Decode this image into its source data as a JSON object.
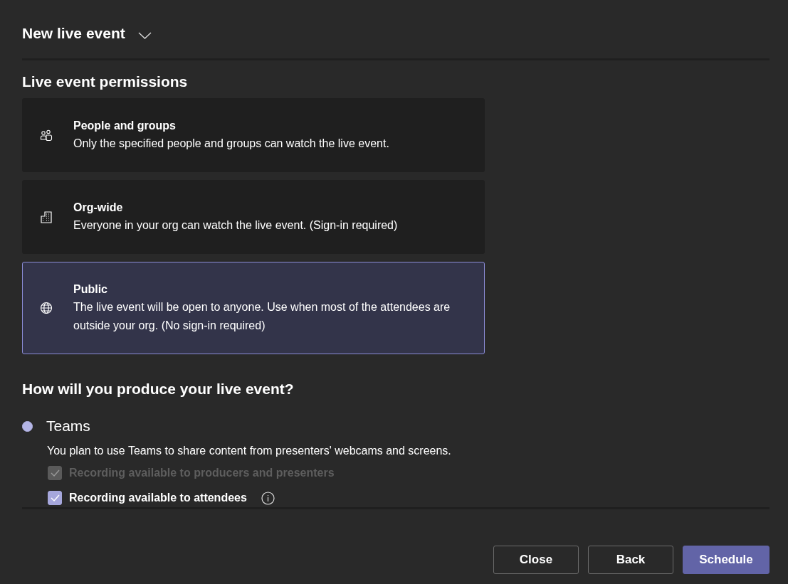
{
  "title": "New live event",
  "permissions": {
    "heading": "Live event permissions",
    "options": [
      {
        "title": "People and groups",
        "description": "Only the specified people and groups can watch the live event.",
        "selected": false
      },
      {
        "title": "Org-wide",
        "description": "Everyone in your org can watch the live event. (Sign-in required)",
        "selected": false
      },
      {
        "title": "Public",
        "description": "The live event will be open to anyone. Use when most of the attendees are outside your org. (No sign-in required)",
        "selected": true
      }
    ]
  },
  "production": {
    "heading": "How will you produce your live event?",
    "methods": [
      {
        "label": "Teams",
        "selected": true,
        "description": "You plan to use Teams to share content from presenters' webcams and screens.",
        "options": [
          {
            "label": "Recording available to producers and presenters",
            "checked": true,
            "disabled": true,
            "info": false
          },
          {
            "label": "Recording available to attendees",
            "checked": true,
            "disabled": false,
            "info": true
          }
        ]
      }
    ]
  },
  "buttons": [
    {
      "label": "Close",
      "kind": "secondary"
    },
    {
      "label": "Back",
      "kind": "secondary"
    },
    {
      "label": "Schedule",
      "kind": "primary"
    }
  ]
}
